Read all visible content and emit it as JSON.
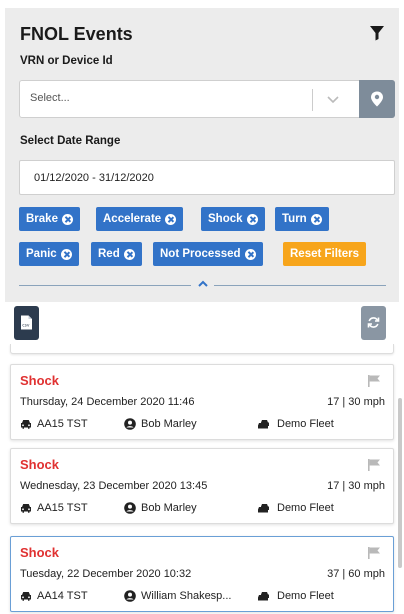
{
  "header": {
    "title": "FNOL Events",
    "filter_icon": "filter-icon"
  },
  "vrn": {
    "label": "VRN or Device Id",
    "placeholder": "Select...",
    "arrow_icon": "chevron-down-icon",
    "location_icon": "map-marker-icon"
  },
  "date_range": {
    "label": "Select Date Range",
    "value": "01/12/2020 - 31/12/2020"
  },
  "filters": {
    "chips": [
      "Brake",
      "Accelerate",
      "Shock",
      "Turn",
      "Panic",
      "Red",
      "Not Processed"
    ],
    "reset_label": "Reset Filters",
    "chip_color": "#3273c8",
    "reset_color": "#f7a51b"
  },
  "toolbar": {
    "csv_icon": "csv-file-icon",
    "csv_text": "csv",
    "refresh_icon": "refresh-icon"
  },
  "events": [
    {
      "type": "Shock",
      "datetime": "Thursday, 24 December 2020 11:46",
      "speed": "17 | 30 mph",
      "vrn": "AA15 TST",
      "driver": "Bob Marley",
      "fleet": "Demo Fleet"
    },
    {
      "type": "Shock",
      "datetime": "Wednesday, 23 December 2020 13:45",
      "speed": "17 | 30 mph",
      "vrn": "AA15 TST",
      "driver": "Bob Marley",
      "fleet": "Demo Fleet"
    },
    {
      "type": "Shock",
      "datetime": "Tuesday, 22 December 2020 10:32",
      "speed": "37 | 60 mph",
      "vrn": "AA14 TST",
      "driver": "William Shakesp...",
      "fleet": "Demo Fleet"
    }
  ],
  "colors": {
    "event_type": "#e03131",
    "panel_bg": "#ececec",
    "selected_border": "#6a9fd6"
  }
}
